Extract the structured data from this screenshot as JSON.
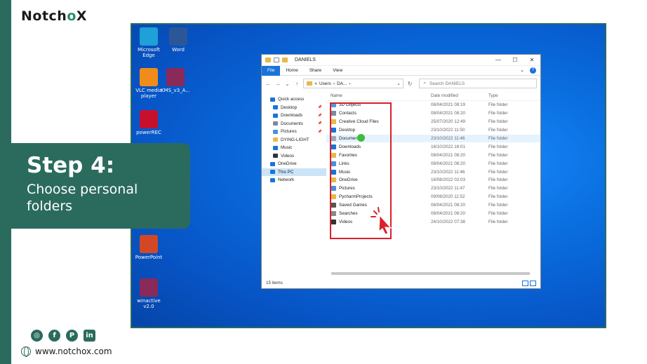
{
  "brand": {
    "prefix": "Notch",
    "accent": "o",
    "suffix": "X",
    "full": "NotchoX",
    "accent_color": "#2a8a70",
    "primary_color": "#2a6b5e"
  },
  "step": {
    "title": "Step 4:",
    "subtitle": "Choose personal folders"
  },
  "social": {
    "icons": [
      "instagram-icon",
      "facebook-icon",
      "pinterest-icon",
      "linkedin-icon"
    ],
    "glyphs": [
      "◎",
      "f",
      "P",
      "in"
    ],
    "website": "www.notchox.com"
  },
  "desktop": {
    "icons": [
      {
        "label": "Microsoft Edge",
        "icon": "edge-icon",
        "color": "#1da1d6"
      },
      {
        "label": "Word",
        "icon": "word-icon",
        "color": "#2b5797"
      },
      {
        "label": "VLC media player",
        "icon": "vlc-icon",
        "color": "#f08c1a"
      },
      {
        "label": "KMS_v3_A...",
        "icon": "winrar-icon",
        "color": "#8a2a5a"
      },
      {
        "label": "powerREC",
        "icon": "record-icon",
        "color": "#c8102e"
      },
      {
        "label": "PowerPoint",
        "icon": "powerpoint-icon",
        "color": "#d24726"
      },
      {
        "label": "winactive v2.0",
        "icon": "winrar-icon",
        "color": "#8a2a5a"
      }
    ]
  },
  "explorer": {
    "title": "DANIELS",
    "window_buttons": [
      "—",
      "☐",
      "✕"
    ],
    "ribbon_tabs": [
      "File",
      "Home",
      "Share",
      "View"
    ],
    "address": {
      "prefix": "«",
      "parts": [
        "Users",
        "DA..."
      ],
      "separator": "›"
    },
    "search_placeholder": "Search DANIELS",
    "nav": [
      {
        "label": "Quick access",
        "icon": "star-icon",
        "color": "#1a73d8",
        "pinned": false,
        "indent": 0
      },
      {
        "label": "Desktop",
        "icon": "desktop-icon",
        "color": "#1a73d8",
        "pinned": true,
        "indent": 1
      },
      {
        "label": "Downloads",
        "icon": "download-icon",
        "color": "#1a73d8",
        "pinned": true,
        "indent": 1
      },
      {
        "label": "Documents",
        "icon": "document-icon",
        "color": "#7a8aa0",
        "pinned": true,
        "indent": 1
      },
      {
        "label": "Pictures",
        "icon": "picture-icon",
        "color": "#4a90d9",
        "pinned": true,
        "indent": 1
      },
      {
        "label": "DYING-LIGHT",
        "icon": "folder-icon",
        "color": "#e8b84a",
        "pinned": false,
        "indent": 1
      },
      {
        "label": "Music",
        "icon": "music-icon",
        "color": "#1a73d8",
        "pinned": false,
        "indent": 1
      },
      {
        "label": "Videos",
        "icon": "video-icon",
        "color": "#333333",
        "pinned": false,
        "indent": 1
      },
      {
        "label": "OneDrive",
        "icon": "cloud-icon",
        "color": "#1a73d8",
        "pinned": false,
        "indent": 0
      },
      {
        "label": "This PC",
        "icon": "pc-icon",
        "color": "#1a73d8",
        "pinned": false,
        "indent": 0,
        "selected": true
      },
      {
        "label": "Network",
        "icon": "network-icon",
        "color": "#1a73d8",
        "pinned": false,
        "indent": 0
      }
    ],
    "columns": [
      "Name",
      "Date modified",
      "Type"
    ],
    "files": [
      {
        "name": "3D Objects",
        "date": "08/04/2021 08:19",
        "type": "File folder",
        "color": "#4a9ee0"
      },
      {
        "name": "Contacts",
        "date": "08/04/2021 08:20",
        "type": "File folder",
        "color": "#7a8aa0"
      },
      {
        "name": "Creative Cloud Files",
        "date": "25/07/2020 12:49",
        "type": "File folder",
        "color": "#e8b84a"
      },
      {
        "name": "Desktop",
        "date": "23/10/2022 11:50",
        "type": "File folder",
        "color": "#1a73d8"
      },
      {
        "name": "Documents",
        "date": "23/10/2022 11:46",
        "type": "File folder",
        "color": "#9aa8b8",
        "hover": true
      },
      {
        "name": "Downloads",
        "date": "16/10/2022 16:01",
        "type": "File folder",
        "color": "#1a73d8"
      },
      {
        "name": "Favorites",
        "date": "08/04/2021 08:20",
        "type": "File folder",
        "color": "#e8b84a"
      },
      {
        "name": "Links",
        "date": "08/04/2021 08:20",
        "type": "File folder",
        "color": "#4a90d9"
      },
      {
        "name": "Music",
        "date": "23/10/2022 11:46",
        "type": "File folder",
        "color": "#1a73d8"
      },
      {
        "name": "OneDrive",
        "date": "16/08/2022 02:03",
        "type": "File folder",
        "color": "#e8b84a"
      },
      {
        "name": "Pictures",
        "date": "23/10/2022 11:47",
        "type": "File folder",
        "color": "#4a90d9"
      },
      {
        "name": "PycharmProjects",
        "date": "09/08/2020 11:52",
        "type": "File folder",
        "color": "#e8b84a"
      },
      {
        "name": "Saved Games",
        "date": "08/04/2021 08:20",
        "type": "File folder",
        "color": "#555555"
      },
      {
        "name": "Searches",
        "date": "08/04/2021 08:20",
        "type": "File folder",
        "color": "#8a8a8a"
      },
      {
        "name": "Videos",
        "date": "24/10/2022 07:38",
        "type": "File folder",
        "color": "#333333"
      }
    ],
    "status": "15 items"
  }
}
